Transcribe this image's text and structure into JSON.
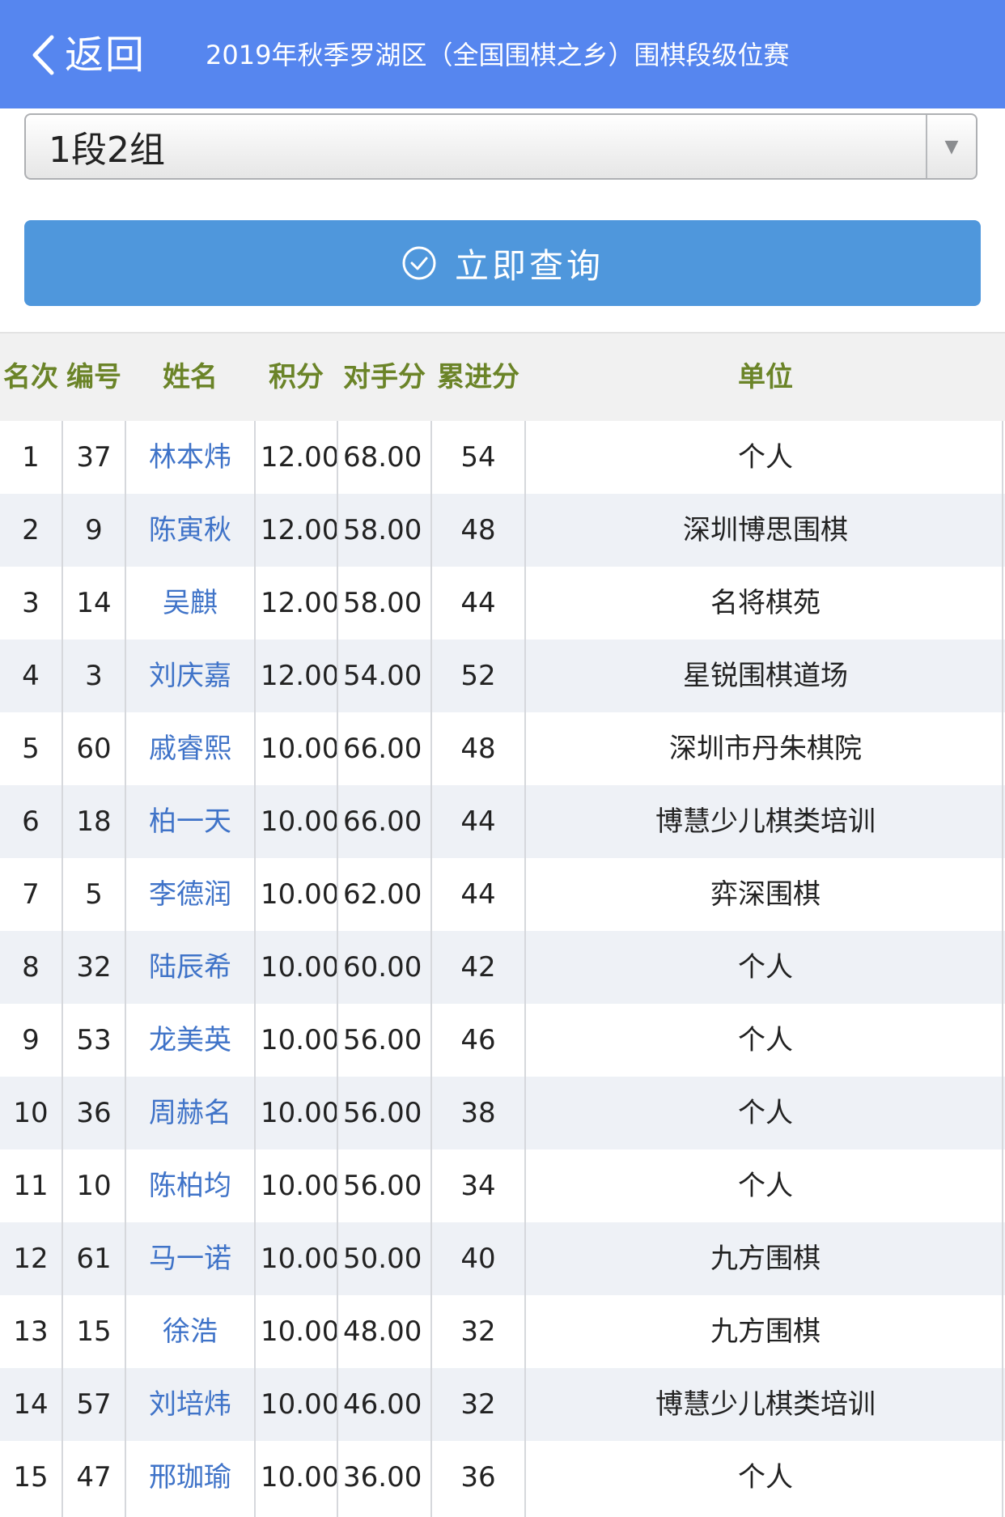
{
  "header": {
    "back_label": "返回",
    "title": "2019年秋季罗湖区（全国围棋之乡）围棋段级位赛"
  },
  "filter": {
    "selected_group": "1段2组"
  },
  "query_button": {
    "label": "立即查询"
  },
  "colors": {
    "header_bg": "#5686ef",
    "button_bg": "#4f97dc",
    "column_header_text": "#6b8428",
    "name_link": "#3f73c8",
    "row_alt_bg": "#eef1f6"
  },
  "table": {
    "columns": [
      "名次",
      "编号",
      "姓名",
      "积分",
      "对手分",
      "累进分",
      "单位"
    ],
    "rows": [
      {
        "rank": "1",
        "num": "37",
        "name": "林本炜",
        "score": "12.00",
        "opp": "68.00",
        "cum": "54",
        "unit": "个人"
      },
      {
        "rank": "2",
        "num": "9",
        "name": "陈寅秋",
        "score": "12.00",
        "opp": "58.00",
        "cum": "48",
        "unit": "深圳博思围棋"
      },
      {
        "rank": "3",
        "num": "14",
        "name": "吴麒",
        "score": "12.00",
        "opp": "58.00",
        "cum": "44",
        "unit": "名将棋苑"
      },
      {
        "rank": "4",
        "num": "3",
        "name": "刘庆嘉",
        "score": "12.00",
        "opp": "54.00",
        "cum": "52",
        "unit": "星锐围棋道场"
      },
      {
        "rank": "5",
        "num": "60",
        "name": "戚睿熙",
        "score": "10.00",
        "opp": "66.00",
        "cum": "48",
        "unit": "深圳市丹朱棋院"
      },
      {
        "rank": "6",
        "num": "18",
        "name": "柏一天",
        "score": "10.00",
        "opp": "66.00",
        "cum": "44",
        "unit": "博慧少儿棋类培训"
      },
      {
        "rank": "7",
        "num": "5",
        "name": "李德润",
        "score": "10.00",
        "opp": "62.00",
        "cum": "44",
        "unit": "弈深围棋"
      },
      {
        "rank": "8",
        "num": "32",
        "name": "陆辰希",
        "score": "10.00",
        "opp": "60.00",
        "cum": "42",
        "unit": "个人"
      },
      {
        "rank": "9",
        "num": "53",
        "name": "龙美英",
        "score": "10.00",
        "opp": "56.00",
        "cum": "46",
        "unit": "个人"
      },
      {
        "rank": "10",
        "num": "36",
        "name": "周赫名",
        "score": "10.00",
        "opp": "56.00",
        "cum": "38",
        "unit": "个人"
      },
      {
        "rank": "11",
        "num": "10",
        "name": "陈柏均",
        "score": "10.00",
        "opp": "56.00",
        "cum": "34",
        "unit": "个人"
      },
      {
        "rank": "12",
        "num": "61",
        "name": "马一诺",
        "score": "10.00",
        "opp": "50.00",
        "cum": "40",
        "unit": "九方围棋"
      },
      {
        "rank": "13",
        "num": "15",
        "name": "徐浩",
        "score": "10.00",
        "opp": "48.00",
        "cum": "32",
        "unit": "九方围棋"
      },
      {
        "rank": "14",
        "num": "57",
        "name": "刘培炜",
        "score": "10.00",
        "opp": "46.00",
        "cum": "32",
        "unit": "博慧少儿棋类培训"
      },
      {
        "rank": "15",
        "num": "47",
        "name": "邢珈瑜",
        "score": "10.00",
        "opp": "36.00",
        "cum": "36",
        "unit": "个人"
      }
    ]
  }
}
